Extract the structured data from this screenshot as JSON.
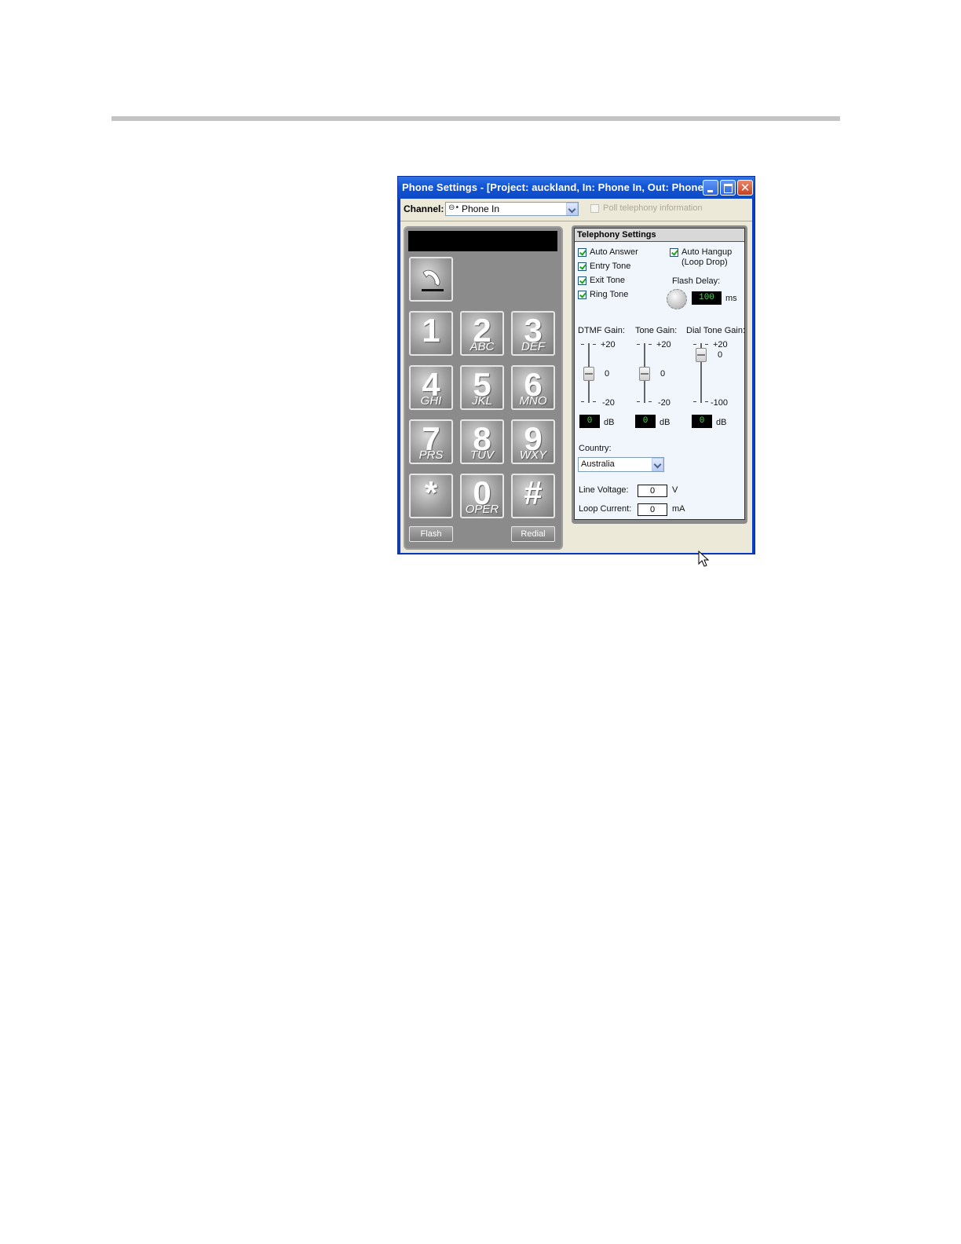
{
  "window": {
    "title": "Phone Settings - [Project: auckland, In: Phone In, Out: Phone…",
    "close_glyph": "✕"
  },
  "channel": {
    "label": "Channel:",
    "value": "Phone In",
    "poll_label": "Poll telephony information",
    "poll_checked": false
  },
  "keypad": {
    "keys": [
      {
        "digit": "1",
        "letters": ""
      },
      {
        "digit": "2",
        "letters": "ABC"
      },
      {
        "digit": "3",
        "letters": "DEF"
      },
      {
        "digit": "4",
        "letters": "GHI"
      },
      {
        "digit": "5",
        "letters": "JKL"
      },
      {
        "digit": "6",
        "letters": "MNO"
      },
      {
        "digit": "7",
        "letters": "PRS"
      },
      {
        "digit": "8",
        "letters": "TUV"
      },
      {
        "digit": "9",
        "letters": "WXY"
      },
      {
        "digit": "*",
        "letters": ""
      },
      {
        "digit": "0",
        "letters": "OPER"
      },
      {
        "digit": "#",
        "letters": ""
      }
    ],
    "flash_label": "Flash",
    "redial_label": "Redial"
  },
  "telephony": {
    "heading": "Telephony Settings",
    "auto_answer": "Auto Answer",
    "entry_tone": "Entry Tone",
    "exit_tone": "Exit Tone",
    "ring_tone": "Ring Tone",
    "auto_hangup": "Auto Hangup",
    "auto_hangup_sub": "(Loop Drop)",
    "flash_delay_label": "Flash Delay:",
    "flash_delay_value": "100",
    "flash_delay_unit": "ms",
    "dtmf_gain": {
      "label": "DTMF Gain:",
      "max": "+20",
      "mid": "0",
      "min": "-20",
      "value": "0",
      "unit": "dB"
    },
    "tone_gain": {
      "label": "Tone Gain:",
      "max": "+20",
      "mid": "0",
      "min": "-20",
      "value": "0",
      "unit": "dB"
    },
    "dial_tone_gain": {
      "label": "Dial Tone Gain:",
      "max": "+20",
      "mid": "0",
      "min": "-100",
      "value": "0",
      "unit": "dB"
    },
    "country_label": "Country:",
    "country_value": "Australia",
    "line_voltage_label": "Line Voltage:",
    "line_voltage_value": "0",
    "line_voltage_unit": "V",
    "loop_current_label": "Loop Current:",
    "loop_current_value": "0",
    "loop_current_unit": "mA"
  }
}
